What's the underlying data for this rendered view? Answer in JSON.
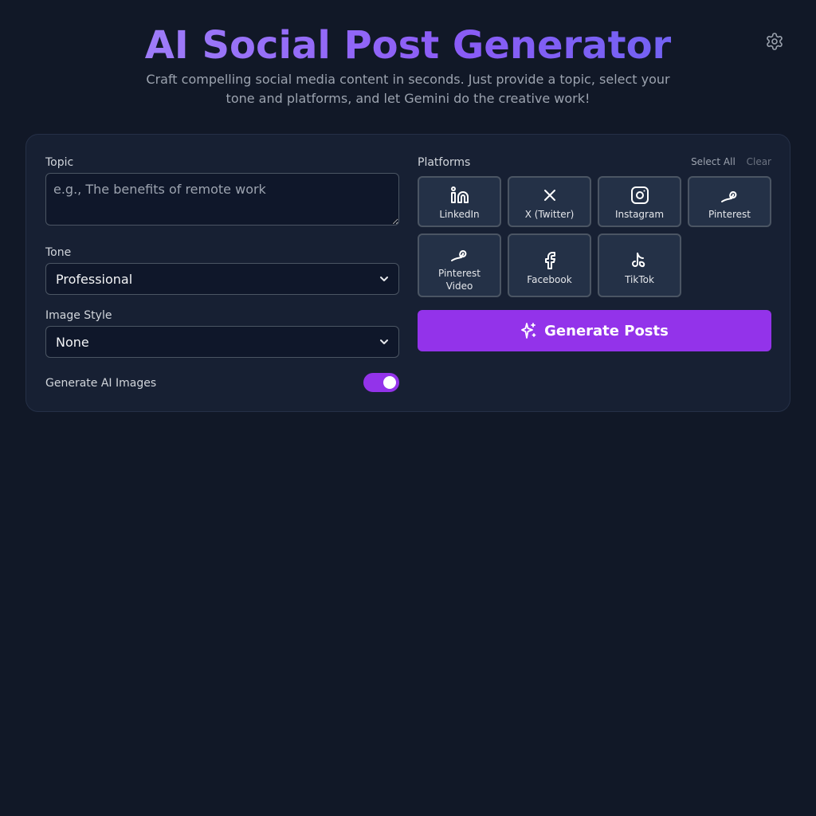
{
  "header": {
    "title": "AI Social Post Generator",
    "subtitle": "Craft compelling social media content in seconds. Just provide a topic, select your tone and platforms, and let Gemini do the creative work!",
    "settings_icon": "gear-icon"
  },
  "form": {
    "topic": {
      "label": "Topic",
      "placeholder": "e.g., The benefits of remote work",
      "value": ""
    },
    "tone": {
      "label": "Tone",
      "selected": "Professional"
    },
    "image_style": {
      "label": "Image Style",
      "selected": "None"
    },
    "ai_images": {
      "label": "Generate AI Images",
      "enabled": true
    }
  },
  "platforms": {
    "label": "Platforms",
    "select_all": "Select All",
    "clear": "Clear",
    "items": [
      {
        "label": "LinkedIn",
        "icon": "linkedin-icon"
      },
      {
        "label": "X (Twitter)",
        "icon": "x-icon"
      },
      {
        "label": "Instagram",
        "icon": "instagram-icon"
      },
      {
        "label": "Pinterest",
        "icon": "pinterest-icon"
      },
      {
        "label": "Pinterest Video",
        "icon": "pinterest-icon"
      },
      {
        "label": "Facebook",
        "icon": "facebook-icon"
      },
      {
        "label": "TikTok",
        "icon": "tiktok-icon"
      }
    ]
  },
  "generate": {
    "label": "Generate Posts",
    "icon": "sparkles-icon"
  },
  "colors": {
    "background": "#111827",
    "card": "#172033",
    "accent": "#9333ea",
    "title_gradient_start": "#a78bfa",
    "title_gradient_end": "#6366f1"
  }
}
